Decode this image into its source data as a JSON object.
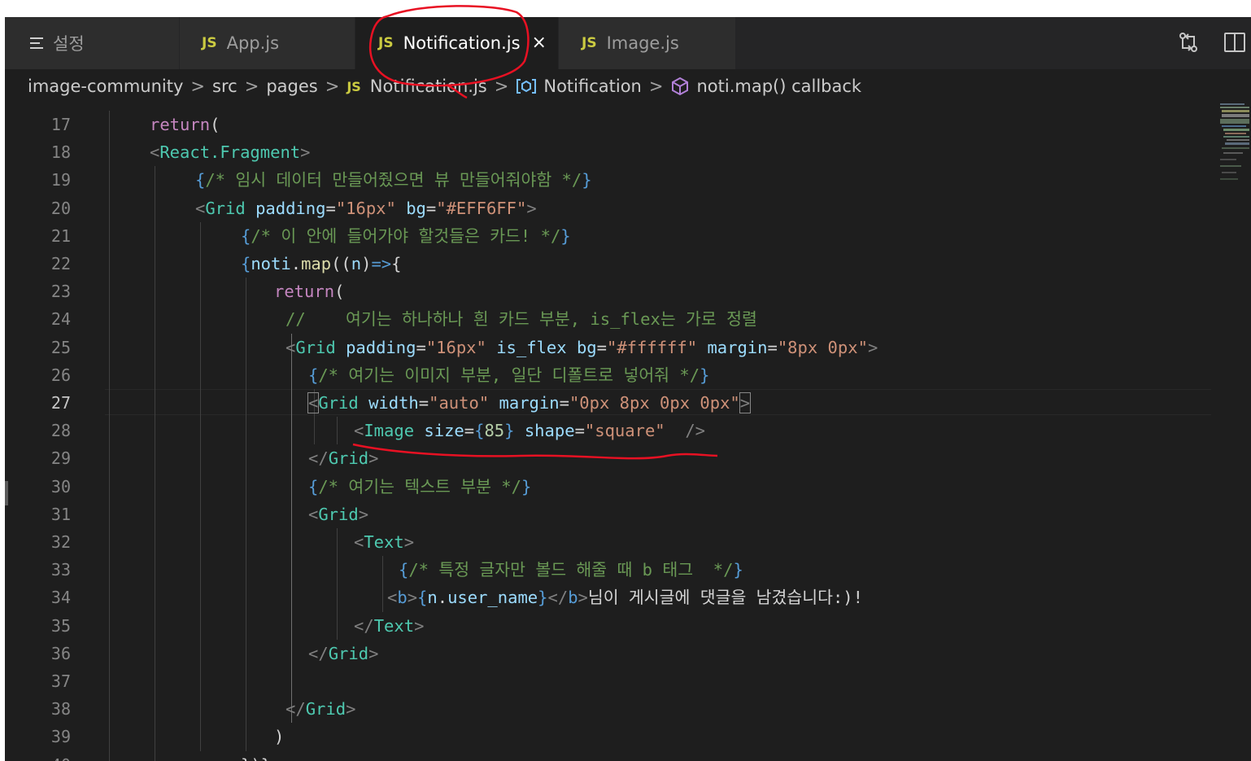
{
  "tabs": [
    {
      "label": "설정",
      "icon": "menu-icon"
    },
    {
      "label": "App.js",
      "badge": "JS"
    },
    {
      "label": "Notification.js",
      "badge": "JS",
      "active": true
    },
    {
      "label": "Image.js",
      "badge": "JS"
    }
  ],
  "tab_close_glyph": "×",
  "toolbar_icons": [
    "open-changes-icon",
    "split-editor-icon"
  ],
  "breadcrumb": {
    "items": [
      "image-community",
      "src",
      "pages"
    ],
    "file_badge": "JS",
    "file": "Notification.js",
    "component": "Notification",
    "callback": "noti.map() callback",
    "separator": ">"
  },
  "editor": {
    "current_line": "27",
    "lines": [
      {
        "no": "17",
        "segs": [
          [
            "kw",
            "return"
          ],
          [
            "pl",
            "("
          ]
        ]
      },
      {
        "no": "18",
        "segs": [
          [
            "pu",
            "<"
          ],
          [
            "tg",
            "React.Fragment"
          ],
          [
            "pu",
            ">"
          ]
        ]
      },
      {
        "no": "19",
        "segs": [
          [
            "br",
            "{"
          ],
          [
            "cm",
            "/* 임시 데이터 만들어줬으면 뷰 만들어줘야함 */"
          ],
          [
            "br",
            "}"
          ]
        ]
      },
      {
        "no": "20",
        "segs": [
          [
            "pu",
            "<"
          ],
          [
            "tg",
            "Grid"
          ],
          [
            "pl",
            " "
          ],
          [
            "at",
            "padding"
          ],
          [
            "pl",
            "="
          ],
          [
            "st",
            "\"16px\""
          ],
          [
            "pl",
            " "
          ],
          [
            "at",
            "bg"
          ],
          [
            "pl",
            "="
          ],
          [
            "st",
            "\"#EFF6FF\""
          ],
          [
            "pu",
            ">"
          ]
        ]
      },
      {
        "no": "21",
        "segs": [
          [
            "br",
            "{"
          ],
          [
            "cm",
            "/* 이 안에 들어가야 할것들은 카드! */"
          ],
          [
            "br",
            "}"
          ]
        ]
      },
      {
        "no": "22",
        "segs": [
          [
            "br",
            "{"
          ],
          [
            "va",
            "noti"
          ],
          [
            "pl",
            "."
          ],
          [
            "fn",
            "map"
          ],
          [
            "pl",
            "(("
          ],
          [
            "va",
            "n"
          ],
          [
            "pl",
            ")"
          ],
          [
            "br",
            "=>"
          ],
          [
            "pl",
            "{"
          ]
        ]
      },
      {
        "no": "23",
        "segs": [
          [
            "kw",
            "return"
          ],
          [
            "pl",
            "("
          ]
        ]
      },
      {
        "no": "24",
        "segs": [
          [
            "cm",
            "//    여기는 하나하나 흰 카드 부분, is_flex는 가로 정렬"
          ]
        ]
      },
      {
        "no": "25",
        "segs": [
          [
            "pu",
            "<"
          ],
          [
            "tg",
            "Grid"
          ],
          [
            "pl",
            " "
          ],
          [
            "at",
            "padding"
          ],
          [
            "pl",
            "="
          ],
          [
            "st",
            "\"16px\""
          ],
          [
            "pl",
            " "
          ],
          [
            "at",
            "is_flex"
          ],
          [
            "pl",
            " "
          ],
          [
            "at",
            "bg"
          ],
          [
            "pl",
            "="
          ],
          [
            "st",
            "\"#ffffff\""
          ],
          [
            "pl",
            " "
          ],
          [
            "at",
            "margin"
          ],
          [
            "pl",
            "="
          ],
          [
            "st",
            "\"8px 0px\""
          ],
          [
            "pu",
            ">"
          ]
        ]
      },
      {
        "no": "26",
        "segs": [
          [
            "br",
            "{"
          ],
          [
            "cm",
            "/* 여기는 이미지 부분, 일단 디폴트로 넣어줘 */"
          ],
          [
            "br",
            "}"
          ]
        ]
      },
      {
        "no": "27",
        "segs": [
          [
            "pub",
            "<"
          ],
          [
            "tg",
            "Grid"
          ],
          [
            "pl",
            " "
          ],
          [
            "at",
            "width"
          ],
          [
            "pl",
            "="
          ],
          [
            "st",
            "\"auto\""
          ],
          [
            "pl",
            " "
          ],
          [
            "at",
            "margin"
          ],
          [
            "pl",
            "="
          ],
          [
            "st",
            "\"0px 8px 0px 0px\""
          ],
          [
            "pub",
            ">"
          ]
        ]
      },
      {
        "no": "28",
        "segs": [
          [
            "pu",
            "<"
          ],
          [
            "tg",
            "Image"
          ],
          [
            "pl",
            " "
          ],
          [
            "at",
            "size"
          ],
          [
            "pl",
            "="
          ],
          [
            "br",
            "{"
          ],
          [
            "nm",
            "85"
          ],
          [
            "br",
            "}"
          ],
          [
            "pl",
            " "
          ],
          [
            "at",
            "shape"
          ],
          [
            "pl",
            "="
          ],
          [
            "st",
            "\"square\""
          ],
          [
            "pl",
            "  "
          ],
          [
            "pu",
            "/>"
          ]
        ]
      },
      {
        "no": "29",
        "segs": [
          [
            "pu",
            "</"
          ],
          [
            "tg",
            "Grid"
          ],
          [
            "pu",
            ">"
          ]
        ]
      },
      {
        "no": "30",
        "segs": [
          [
            "br",
            "{"
          ],
          [
            "cm",
            "/* 여기는 텍스트 부분 */"
          ],
          [
            "br",
            "}"
          ]
        ]
      },
      {
        "no": "31",
        "segs": [
          [
            "pu",
            "<"
          ],
          [
            "tg",
            "Grid"
          ],
          [
            "pu",
            ">"
          ]
        ]
      },
      {
        "no": "32",
        "segs": [
          [
            "pu",
            "<"
          ],
          [
            "tg",
            "Text"
          ],
          [
            "pu",
            ">"
          ]
        ]
      },
      {
        "no": "33",
        "segs": [
          [
            "br",
            "{"
          ],
          [
            "cm",
            "/* 특정 글자만 볼드 해줄 때 b 태그  */"
          ],
          [
            "br",
            "}"
          ]
        ]
      },
      {
        "no": "34",
        "segs": [
          [
            "pu",
            "<"
          ],
          [
            "br",
            "b"
          ],
          [
            "pu",
            ">"
          ],
          [
            "br",
            "{"
          ],
          [
            "va",
            "n"
          ],
          [
            "pl",
            "."
          ],
          [
            "va",
            "user_name"
          ],
          [
            "br",
            "}"
          ],
          [
            "pu",
            "</"
          ],
          [
            "br",
            "b"
          ],
          [
            "pu",
            ">"
          ],
          [
            "pl",
            "님이 게시글에 댓글을 남겼습니다:)!"
          ]
        ]
      },
      {
        "no": "35",
        "segs": [
          [
            "pu",
            "</"
          ],
          [
            "tg",
            "Text"
          ],
          [
            "pu",
            ">"
          ]
        ]
      },
      {
        "no": "36",
        "segs": [
          [
            "pu",
            "</"
          ],
          [
            "tg",
            "Grid"
          ],
          [
            "pu",
            ">"
          ]
        ]
      },
      {
        "no": "37",
        "segs": []
      },
      {
        "no": "38",
        "segs": [
          [
            "pu",
            "</"
          ],
          [
            "tg",
            "Grid"
          ],
          [
            "pu",
            ">"
          ]
        ]
      },
      {
        "no": "39",
        "segs": [
          [
            "pl",
            ")"
          ]
        ]
      }
    ],
    "partial_line": {
      "no": "40",
      "text": "})}"
    }
  }
}
